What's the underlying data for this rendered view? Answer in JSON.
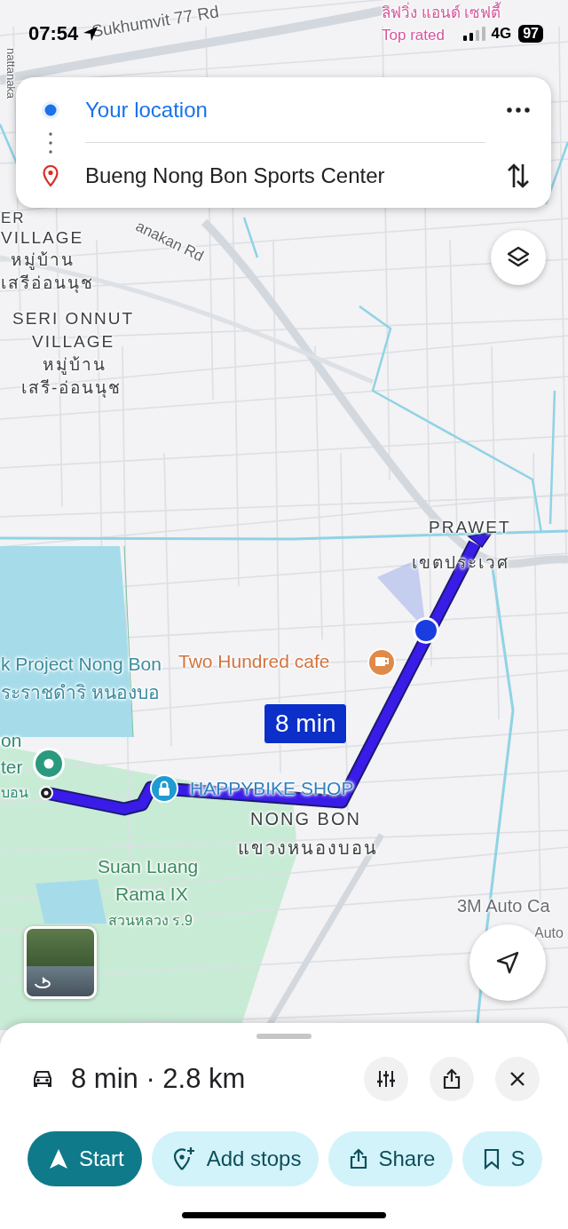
{
  "status_bar": {
    "time": "07:54",
    "network": "4G",
    "battery": "97"
  },
  "directions": {
    "origin": "Your location",
    "destination": "Bueng Nong Bon Sports Center"
  },
  "map": {
    "labels": [
      {
        "kind": "road",
        "text": "Sukhumvit 77 Rd"
      },
      {
        "kind": "road",
        "text": "nattanaka"
      },
      {
        "kind": "poi",
        "text": "ลิฟวิ่ง แอนด์ เซฟตี้"
      },
      {
        "kind": "poi",
        "text": "Top rated"
      },
      {
        "kind": "area",
        "text": "ER"
      },
      {
        "kind": "area",
        "text": "VILLAGE"
      },
      {
        "kind": "area",
        "text": "หมู่บ้าน"
      },
      {
        "kind": "area",
        "text": "เสรีอ่อนนุช"
      },
      {
        "kind": "road",
        "text": "anakan Rd"
      },
      {
        "kind": "area",
        "text": "SERI ONNUT"
      },
      {
        "kind": "area",
        "text": "VILLAGE"
      },
      {
        "kind": "area",
        "text": "หมู่บ้าน"
      },
      {
        "kind": "area",
        "text": "เสรี-อ่อนนุช"
      },
      {
        "kind": "area",
        "text": "PRAWET"
      },
      {
        "kind": "area",
        "text": "เขตประเวศ"
      },
      {
        "kind": "water",
        "text": "k Project Nong Bon"
      },
      {
        "kind": "water",
        "text": "ระราชดำริ หนองบอ"
      },
      {
        "kind": "cafe",
        "text": "Two Hundred cafe"
      },
      {
        "kind": "destination",
        "text": "on"
      },
      {
        "kind": "destination",
        "text": "ter"
      },
      {
        "kind": "destination",
        "text": "บอน"
      },
      {
        "kind": "shop",
        "text": "HAPPYBIKE SHOP"
      },
      {
        "kind": "area",
        "text": "NONG BON"
      },
      {
        "kind": "area",
        "text": "แขวงหนองบอน"
      },
      {
        "kind": "park",
        "text": "Suan Luang"
      },
      {
        "kind": "park",
        "text": "Rama IX"
      },
      {
        "kind": "park",
        "text": "สวนหลวง ร.9"
      },
      {
        "kind": "business",
        "text": "3M Auto Ca"
      },
      {
        "kind": "business",
        "text": "Auto"
      }
    ],
    "route_callout": "8 min"
  },
  "trip": {
    "summary": "8 min · 2.8 km"
  },
  "actions": [
    {
      "kind": "start",
      "label": "Start"
    },
    {
      "kind": "add-stop",
      "label": "Add stops"
    },
    {
      "kind": "share",
      "label": "Share"
    },
    {
      "kind": "save",
      "label": "S"
    }
  ]
}
